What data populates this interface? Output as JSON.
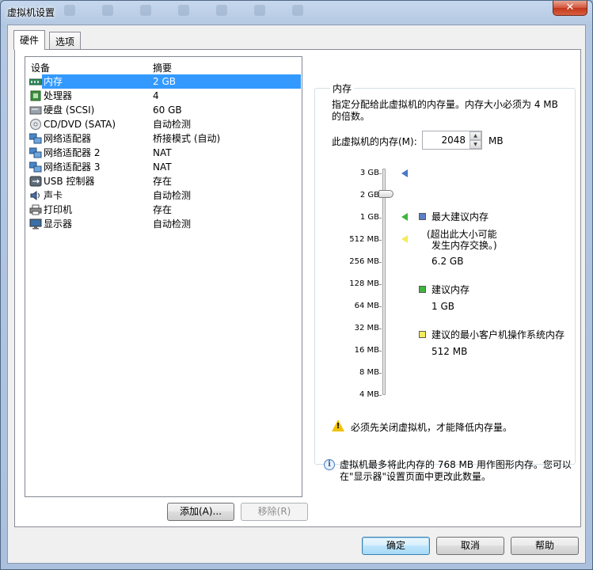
{
  "window": {
    "title": "虚拟机设置",
    "close": "✕"
  },
  "tabs": [
    "硬件",
    "选项"
  ],
  "device_list": {
    "headers": {
      "device": "设备",
      "summary": "摘要"
    },
    "rows": [
      {
        "name": "内存",
        "summary": "2 GB",
        "icon": "memory-icon",
        "selected": true
      },
      {
        "name": "处理器",
        "summary": "4",
        "icon": "processor-icon"
      },
      {
        "name": "硬盘 (SCSI)",
        "summary": "60 GB",
        "icon": "harddisk-icon"
      },
      {
        "name": "CD/DVD (SATA)",
        "summary": "自动检测",
        "icon": "cd-dvd-icon"
      },
      {
        "name": "网络适配器",
        "summary": "桥接模式 (自动)",
        "icon": "network-adapter-icon"
      },
      {
        "name": "网络适配器 2",
        "summary": "NAT",
        "icon": "network-adapter-icon"
      },
      {
        "name": "网络适配器 3",
        "summary": "NAT",
        "icon": "network-adapter-icon"
      },
      {
        "name": "USB 控制器",
        "summary": "存在",
        "icon": "usb-icon"
      },
      {
        "name": "声卡",
        "summary": "自动检测",
        "icon": "sound-icon"
      },
      {
        "name": "打印机",
        "summary": "存在",
        "icon": "printer-icon"
      },
      {
        "name": "显示器",
        "summary": "自动检测",
        "icon": "display-icon"
      }
    ],
    "add_button": "添加(A)...",
    "remove_button": "移除(R)"
  },
  "memory": {
    "group_title": "内存",
    "description": "指定分配给此虚拟机的内存量。内存大小必须为 4 MB 的倍数。",
    "field_label": "此虚拟机的内存(M):",
    "value": "2048",
    "unit": "MB",
    "scale_labels": [
      "3 GB",
      "2 GB",
      "1 GB",
      "512 MB",
      "256 MB",
      "128 MB",
      "64 MB",
      "32 MB",
      "16 MB",
      "8 MB",
      "4 MB"
    ],
    "legend": {
      "max": {
        "label": "最大建议内存",
        "note_line1": "(超出此大小可能",
        "note_line2": "发生内存交换。)",
        "value": "6.2 GB",
        "color": "#5b7fc7"
      },
      "recommended": {
        "label": "建议内存",
        "value": "1 GB",
        "color": "#3fb53f"
      },
      "min_guest": {
        "label": "建议的最小客户机操作系统内存",
        "value": "512 MB",
        "color": "#f4ec5a"
      }
    },
    "current_marker_color": "#4a78c4",
    "warning": "必须先关闭虚拟机，才能降低内存量。",
    "info": "虚拟机最多将此内存的 768 MB 用作图形内存。您可以在\"显示器\"设置页面中更改此数量。"
  },
  "footer": {
    "ok": "确定",
    "cancel": "取消",
    "help": "帮助"
  }
}
